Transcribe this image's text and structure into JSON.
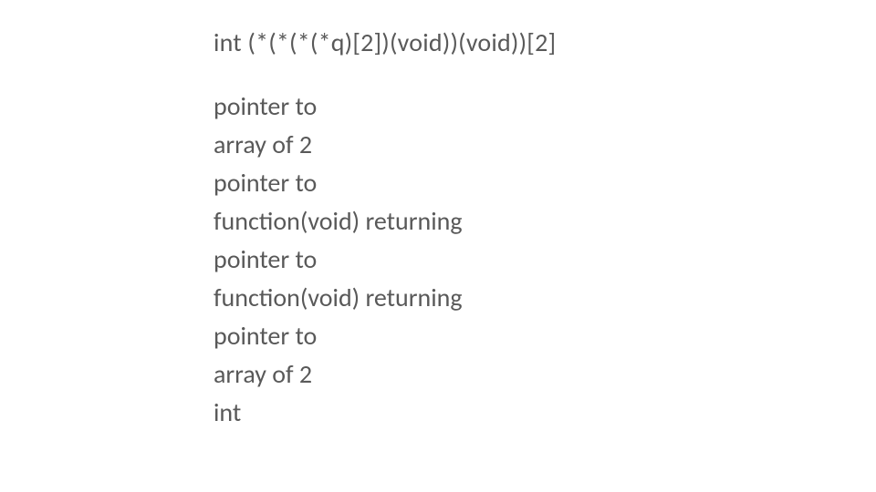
{
  "declaration": "int (*(*(*(*q)[2])(void))(void))[2]",
  "explanation": [
    "pointer to",
    "array of 2",
    "pointer to",
    "function(void) returning",
    "pointer to",
    "function(void) returning",
    "pointer to",
    "array of 2",
    "int"
  ]
}
